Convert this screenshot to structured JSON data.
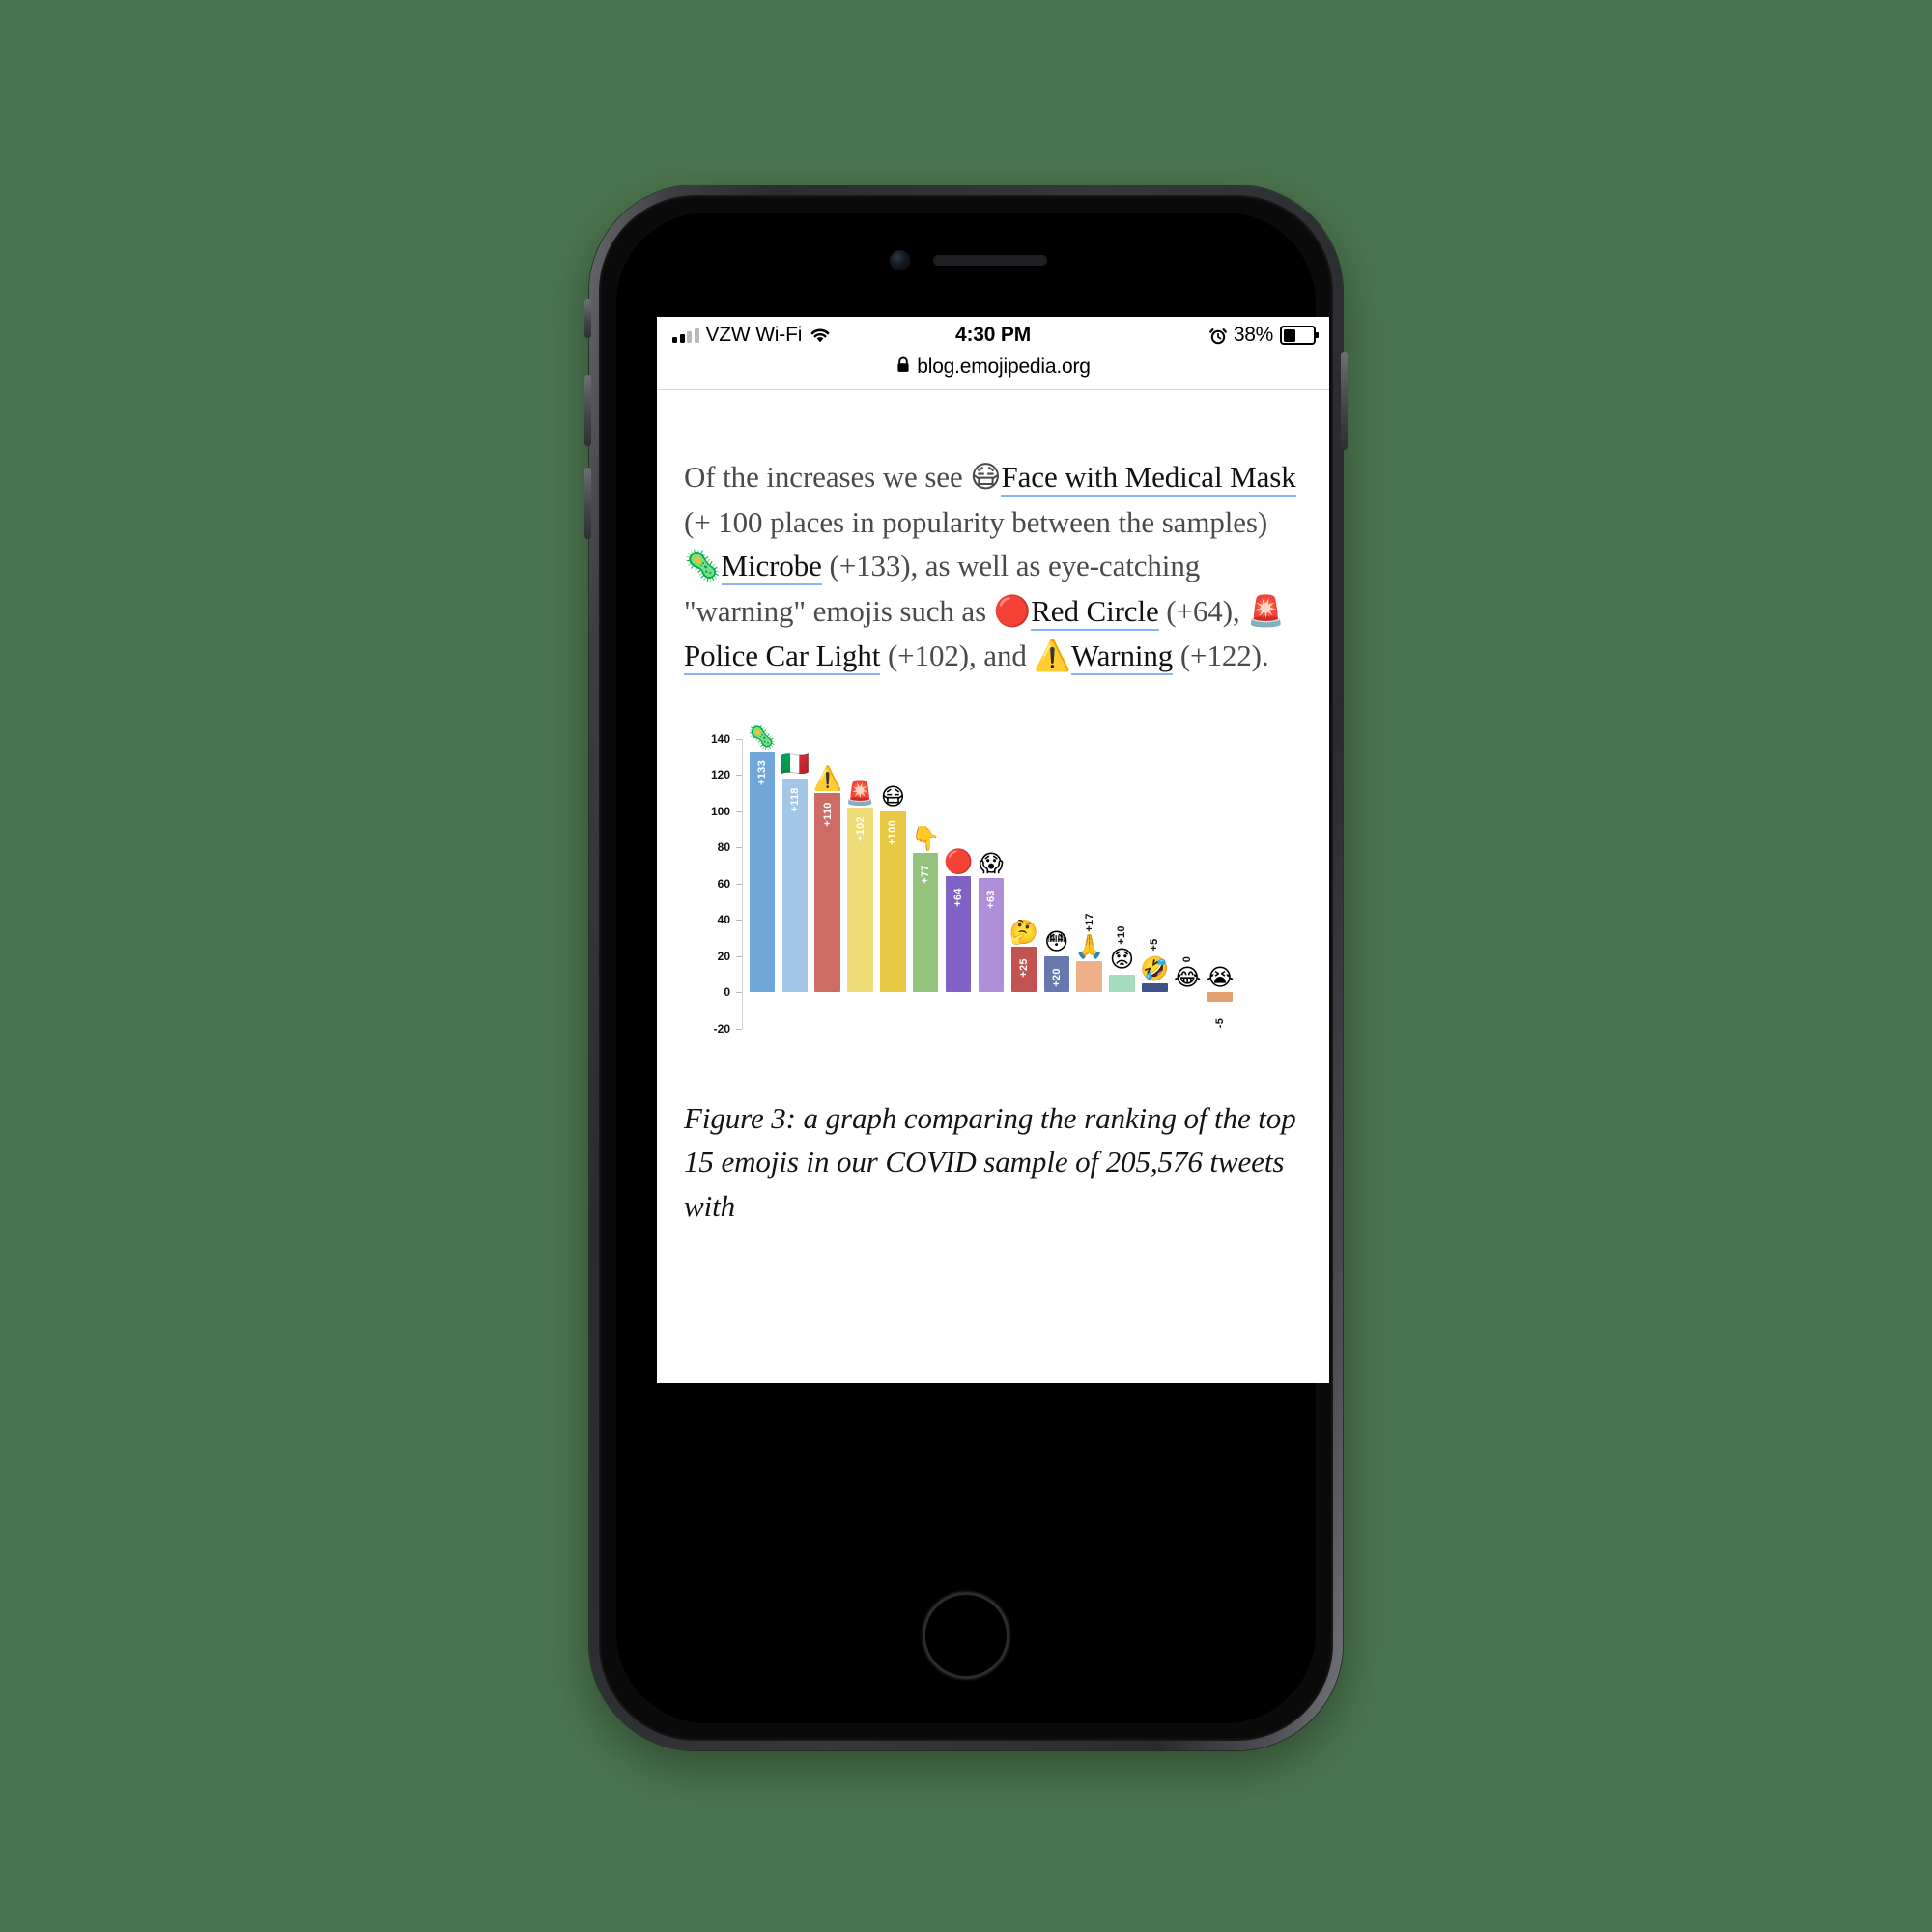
{
  "device": {
    "type": "smartphone",
    "home_button": "home-button",
    "camera": "front-camera",
    "speaker": "earpiece-speaker"
  },
  "status_bar": {
    "carrier": "VZW Wi-Fi",
    "signal_icon": "cellular-signal-icon",
    "wifi_icon": "wifi-icon",
    "time": "4:30 PM",
    "alarm_icon": "alarm-clock-icon",
    "battery_percent": "38%",
    "battery_level": 38,
    "battery_icon": "battery-icon"
  },
  "browser": {
    "lock_icon": "lock-icon",
    "url": "blog.emojipedia.org"
  },
  "article": {
    "paragraph": {
      "t1": "Of the increases we see ",
      "e1": "😷",
      "l1": "Face with Medical Mask",
      "t2": " (+ 100 places in popularity between the samples) ",
      "e2": "🦠",
      "l2": "Microbe",
      "t3": " (+133), as well as eye-catching \"warning\" emojis such as ",
      "e3": "🔴",
      "l3": "Red Circle",
      "t4": " (+64), ",
      "e4": "🚨",
      "l4": "Police Car Light",
      "t5": " (+102), and ",
      "e5": "⚠️",
      "l5": "Warning",
      "t6": " (+122)."
    },
    "caption": "Figure 3: a graph comparing the ranking of the top 15 emojis in our COVID sample of 205,576 tweets with"
  },
  "chart_data": {
    "type": "bar",
    "title": "",
    "xlabel": "",
    "ylabel": "",
    "ylim": [
      -20,
      140
    ],
    "yticks": [
      -20,
      0,
      20,
      40,
      60,
      80,
      100,
      120,
      140
    ],
    "ytick_labels": [
      "-20",
      "0",
      "20",
      "40",
      "60",
      "80",
      "100",
      "120",
      "140"
    ],
    "grid": false,
    "legend": "none",
    "categories": [
      "🦠 Microbe",
      "🇮🇹 Flag Italy",
      "⚠️ Warning",
      "🚨 Police Car Light",
      "😷 Face with Medical Mask",
      "👇 Backhand Index Pointing Down",
      "🔴 Red Circle",
      "😱 Face Screaming in Fear",
      "🤔 Thinking Face",
      "😳 Flushed Face",
      "🙏 Folded Hands",
      "😟 Worried Face",
      "🤣 Rolling on the Floor Laughing",
      "😂 Face with Tears of Joy",
      "😭 Loudly Crying Face"
    ],
    "emojis": [
      "🦠",
      "🇮🇹",
      "⚠️",
      "🚨",
      "😷",
      "👇",
      "🔴",
      "😱",
      "🤔",
      "😳",
      "🙏",
      "😟",
      "🤣",
      "😂",
      "😭"
    ],
    "values": [
      133,
      118,
      110,
      102,
      100,
      77,
      64,
      63,
      25,
      20,
      17,
      10,
      5,
      0,
      -5
    ],
    "value_labels": [
      "+133",
      "+118",
      "+110",
      "+102",
      "+100",
      "+77",
      "+64",
      "+63",
      "+25",
      "+20",
      "+17",
      "+10",
      "+5",
      "0",
      "-5"
    ],
    "colors": [
      "#71a6d8",
      "#a3c5e6",
      "#cd6c64",
      "#eedd77",
      "#e8c742",
      "#93c47d",
      "#8261c4",
      "#ae8ed8",
      "#c15450",
      "#6679ad",
      "#eeb089",
      "#a5dcc0",
      "#3f5287",
      "#ffffff",
      "#e5a06f"
    ]
  }
}
